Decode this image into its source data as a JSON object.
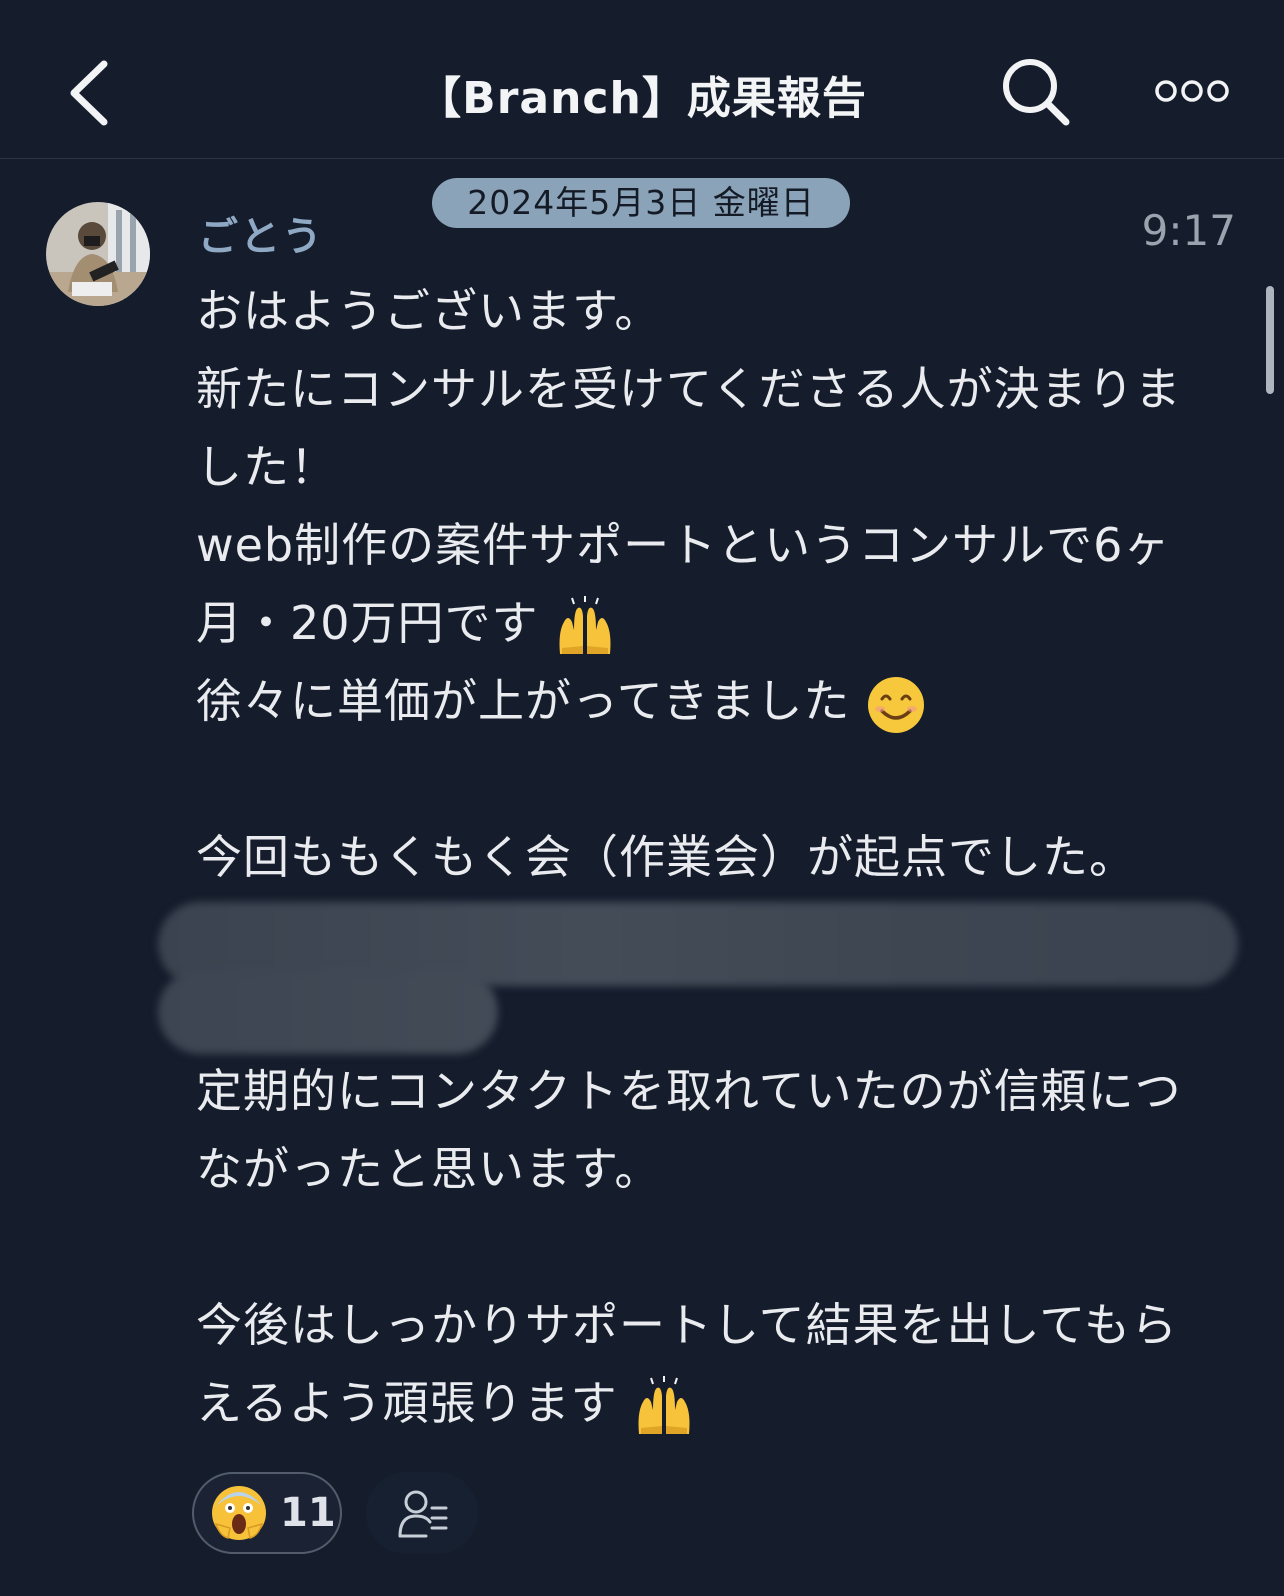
{
  "header": {
    "title": "【Branch】成果報告",
    "back_icon": "chevron-left-icon",
    "search_icon": "search-icon",
    "more_icon": "more-horizontal-icon"
  },
  "date_separator": "2024年5月3日 金曜日",
  "message": {
    "author": "ごとう",
    "time": "9:17",
    "lines": [
      "おはようございます。",
      "新たにコンサルを受けてくださる人が決まりま",
      "した！",
      "web制作の案件サポートというコンサルで6ヶ",
      "月・20万円です",
      "徐々に単価が上がってきました",
      "今回ももくもく会（作業会）が起点でした。",
      "定期的にコンタクトを取れていたのが信頼につ",
      "ながったと思います。",
      "今後はしっかりサポートして結果を出してもら",
      "えるよう頑張ります"
    ]
  },
  "reaction": {
    "emoji": "face-screaming-emoji",
    "count": "11"
  },
  "read_receipts_icon": "person-list-icon",
  "colors": {
    "background": "#151d2c",
    "author": "#8fa8c3",
    "date_pill": "#8aa3b8"
  }
}
